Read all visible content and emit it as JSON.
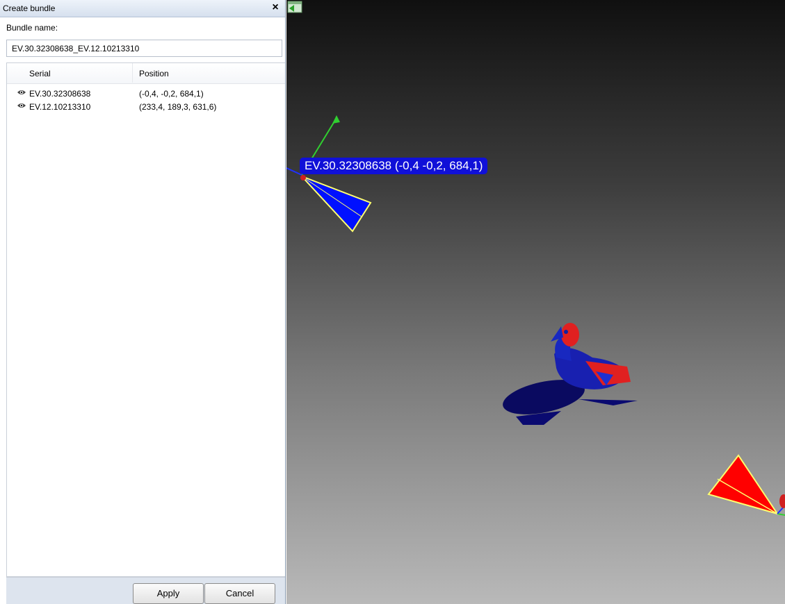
{
  "dialog": {
    "title": "Create bundle",
    "close_glyph": "×",
    "bundle_name_label": "Bundle name:",
    "bundle_name_value": "EV.30.32308638_EV.12.10213310"
  },
  "list": {
    "columns": [
      "Serial",
      "Position"
    ],
    "rows": [
      {
        "icon": "eye-icon",
        "serial": "EV.30.32308638",
        "position": "(-0,4, -0,2, 684,1)"
      },
      {
        "icon": "eye-icon",
        "serial": "EV.12.10213310",
        "position": "(233,4, 189,3, 631,6)"
      }
    ]
  },
  "buttons": {
    "apply": "Apply",
    "cancel": "Cancel"
  },
  "viewport": {
    "camera_label": "EV.30.32308638 (-0,4 -0,2, 684,1)",
    "colors": {
      "label_bg": "#1010d8",
      "camera_blue": "#0000ff",
      "camera_red": "#ff0000",
      "frustum_outline": "#ffff66",
      "background_top": "#101010",
      "background_bottom": "#b9b9b9"
    },
    "corner_icon": "expand-panel-icon"
  }
}
